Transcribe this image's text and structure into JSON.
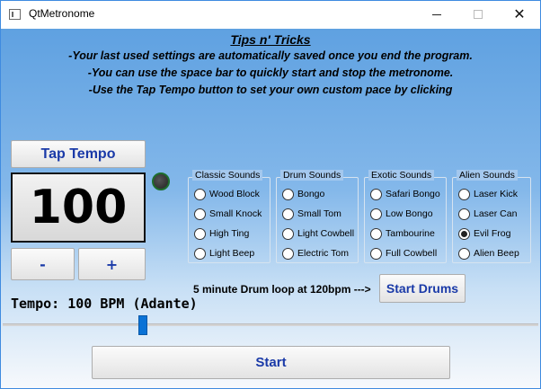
{
  "window": {
    "title": "QtMetronome",
    "icon": "app-window-icon",
    "controls": {
      "minimize": "minimize-icon",
      "maximize": "maximize-icon",
      "close": "✕"
    }
  },
  "tips": {
    "title": "Tips n' Tricks",
    "lines": [
      "-Your last used settings are automatically saved once you end the program.",
      "-You can use the space bar to quickly start and stop the metronome.",
      "-Use the Tap Tempo button to set your own custom pace by clicking"
    ]
  },
  "tempo": {
    "tap_label": "Tap Tempo",
    "bpm_value": "100",
    "minus_label": "-",
    "plus_label": "+",
    "tempo_text": "Tempo: 100 BPM (Adante)",
    "slider_value": 100
  },
  "sound_groups": [
    {
      "title": "Classic Sounds",
      "options": [
        "Wood Block",
        "Small Knock",
        "High Ting",
        "Light Beep"
      ],
      "selected": null
    },
    {
      "title": "Drum Sounds",
      "options": [
        "Bongo",
        "Small Tom",
        "Light Cowbell",
        "Electric Tom"
      ],
      "selected": null
    },
    {
      "title": "Exotic Sounds",
      "options": [
        "Safari Bongo",
        "Low Bongo",
        "Tambourine",
        "Full Cowbell"
      ],
      "selected": null
    },
    {
      "title": "Alien Sounds",
      "options": [
        "Laser Kick",
        "Laser Can",
        "Evil Frog",
        "Alien Beep"
      ],
      "selected": "Evil Frog"
    }
  ],
  "drum_loop": {
    "label": "5 minute Drum loop at 120bpm --->",
    "button_label": "Start Drums"
  },
  "start_button_label": "Start",
  "colors": {
    "button_text": "#1a3aa8",
    "background_top": "#5fa1e1",
    "slider_handle": "#0a72d6",
    "led_border": "#1e6d2d"
  }
}
